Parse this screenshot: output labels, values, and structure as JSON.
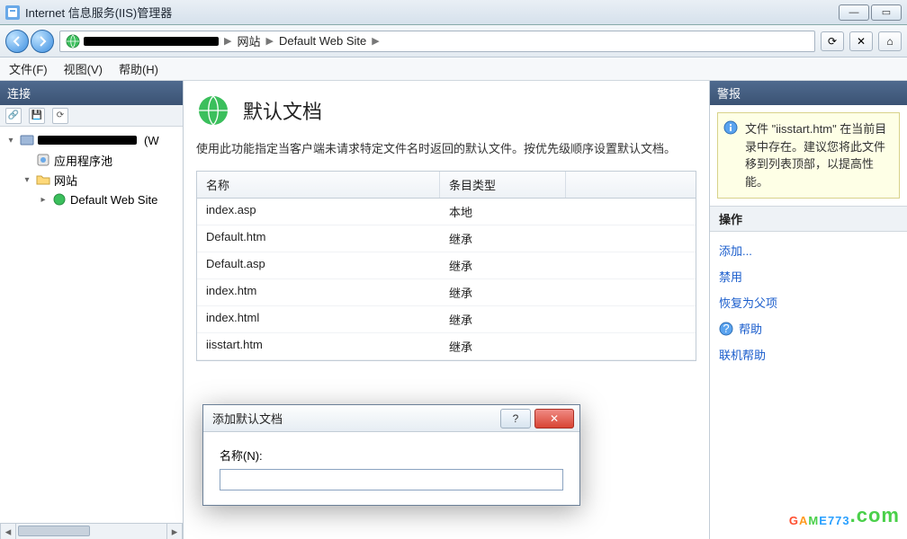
{
  "window": {
    "title": "Internet 信息服务(IIS)管理器"
  },
  "breadcrumb": {
    "segments": [
      "网站",
      "Default Web Site"
    ]
  },
  "menu": {
    "file": "文件(F)",
    "view": "视图(V)",
    "help": "帮助(H)"
  },
  "panels": {
    "connections": "连接",
    "alerts": "警报",
    "actions": "操作"
  },
  "tree": {
    "server_suffix": "(W",
    "app_pools": "应用程序池",
    "sites": "网站",
    "default_site": "Default Web Site"
  },
  "page": {
    "title": "默认文档",
    "desc": "使用此功能指定当客户端未请求特定文件名时返回的默认文件。按优先级顺序设置默认文档。"
  },
  "grid": {
    "col_name": "名称",
    "col_type": "条目类型",
    "rows": [
      {
        "name": "index.asp",
        "type": "本地"
      },
      {
        "name": "Default.htm",
        "type": "继承"
      },
      {
        "name": "Default.asp",
        "type": "继承"
      },
      {
        "name": "index.htm",
        "type": "继承"
      },
      {
        "name": "index.html",
        "type": "继承"
      },
      {
        "name": "iisstart.htm",
        "type": "继承"
      }
    ]
  },
  "alert": {
    "text": "文件 \"iisstart.htm\" 在当前目录中存在。建议您将此文件移到列表顶部，以提高性能。"
  },
  "actions": {
    "add": "添加...",
    "disable": "禁用",
    "revert": "恢复为父项",
    "help": "帮助",
    "online_help": "联机帮助"
  },
  "dialog": {
    "title": "添加默认文档",
    "field_label": "名称(N):",
    "value": ""
  },
  "watermark": {
    "brand": "GAME773",
    "suffix": ".com"
  }
}
